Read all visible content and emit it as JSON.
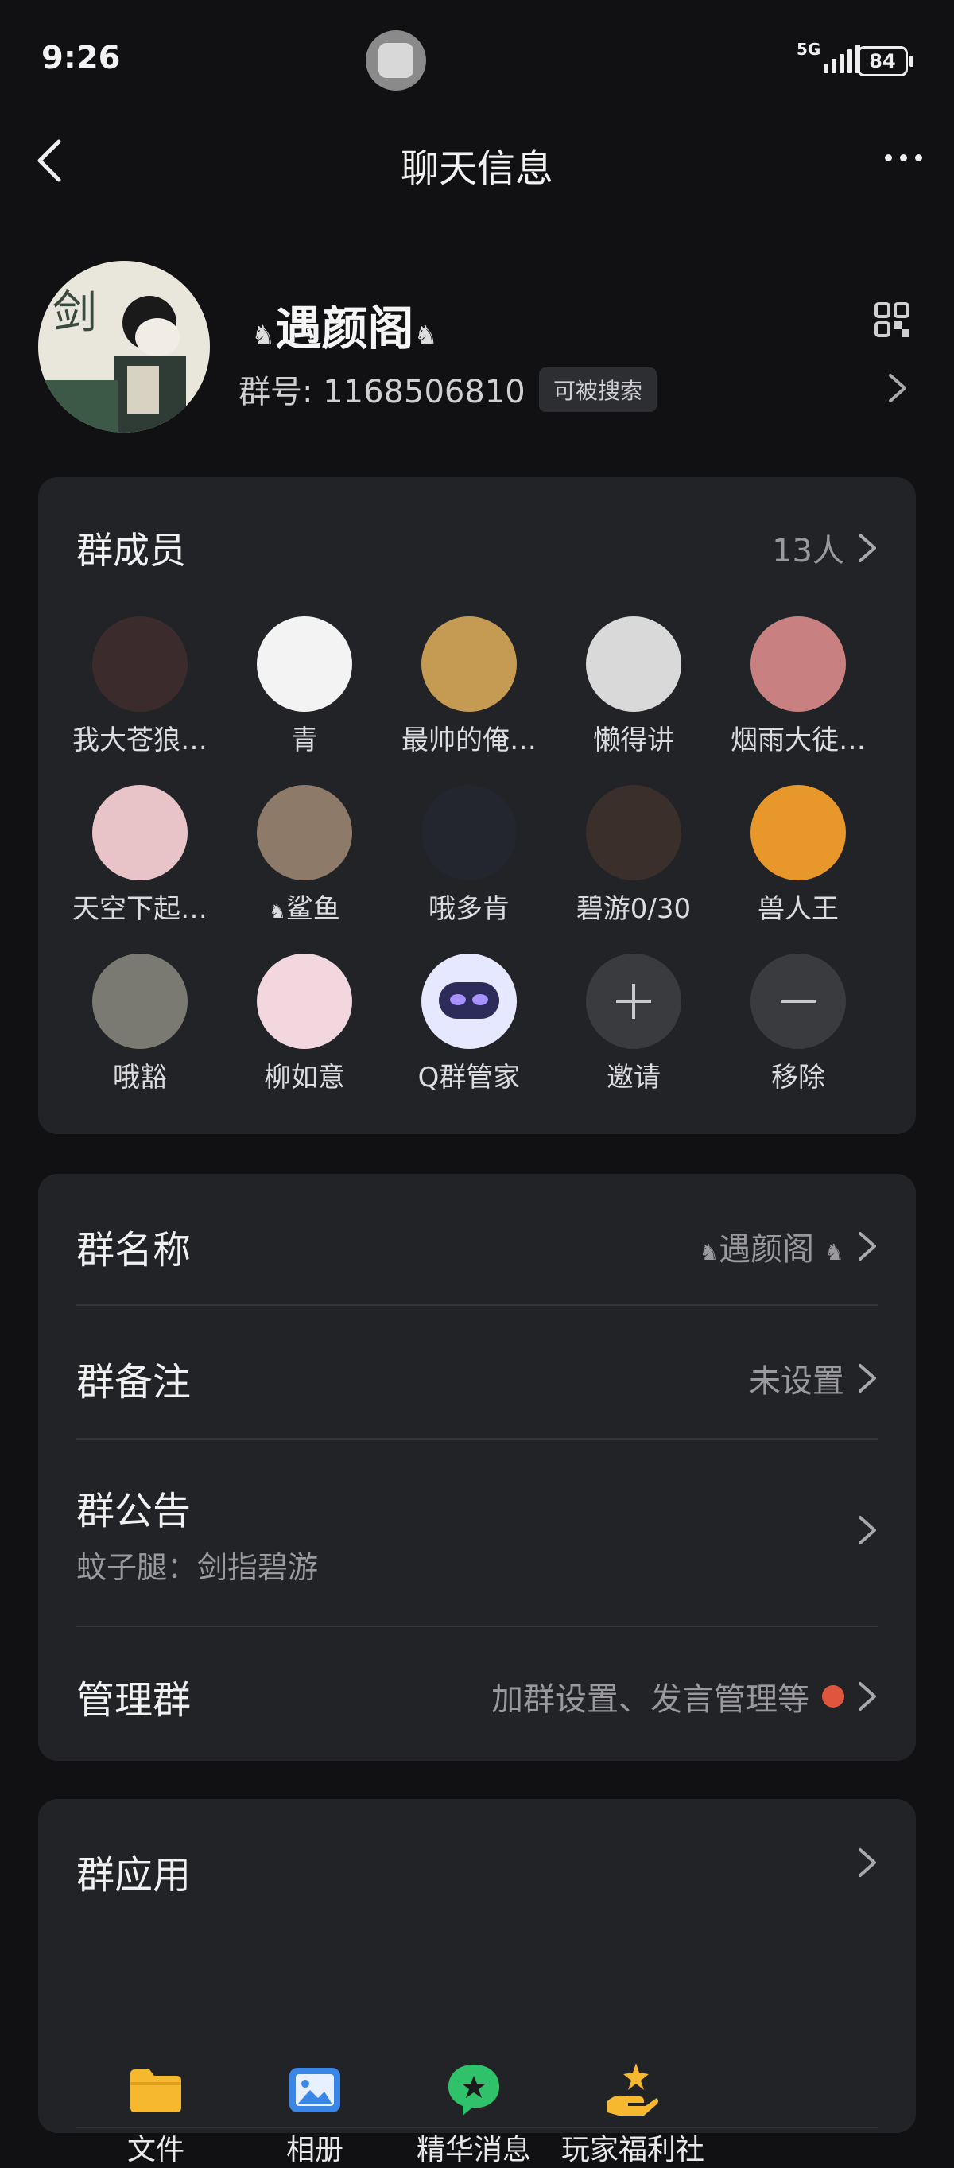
{
  "status_bar": {
    "time": "9:26",
    "network": "5G",
    "battery": "84"
  },
  "nav": {
    "title": "聊天信息"
  },
  "group": {
    "name": "遇颜阁",
    "id_label": "群号:",
    "id_value": "1168506810",
    "search_tag": "可被搜索"
  },
  "members_card": {
    "title": "群成员",
    "count": "13人",
    "members": [
      {
        "name": "我大苍狼…",
        "color": "#3b2b2c"
      },
      {
        "name": "青",
        "color": "#f3f3f3"
      },
      {
        "name": "最帅的俺…",
        "color": "#c59a52"
      },
      {
        "name": "懒得讲",
        "color": "#d9d9d9"
      },
      {
        "name": "烟雨大徒…",
        "color": "#c98080"
      },
      {
        "name": "天空下起…",
        "color": "#e8c4c8"
      },
      {
        "name": "鲨鱼",
        "color": "#8d7a68"
      },
      {
        "name": "哦多肯",
        "color": "#23262e"
      },
      {
        "name": "碧游0/30",
        "color": "#3a2f2a"
      },
      {
        "name": "兽人王",
        "color": "#e8972b"
      },
      {
        "name": "哦豁",
        "color": "#7a7a72"
      },
      {
        "name": "柳如意",
        "color": "#f3d7df"
      },
      {
        "name": "Q群管家",
        "color": "#e6e8ff"
      }
    ],
    "invite_label": "邀请",
    "remove_label": "移除"
  },
  "settings_card": {
    "group_name_label": "群名称",
    "group_name_value": "遇颜阁",
    "remark_label": "群备注",
    "remark_value": "未设置",
    "notice_label": "群公告",
    "notice_value": "蚊子腿：剑指碧游",
    "manage_label": "管理群",
    "manage_value": "加群设置、发言管理等"
  },
  "apps_card": {
    "title": "群应用",
    "apps": [
      {
        "label": "文件",
        "icon": "folder-icon"
      },
      {
        "label": "相册",
        "icon": "album-icon"
      },
      {
        "label": "精华消息",
        "icon": "star-chat-icon"
      },
      {
        "label": "玩家福利社",
        "icon": "gift-hand-icon"
      }
    ]
  },
  "colors": {
    "background": "#111113",
    "card": "#222326",
    "accent_red": "#e0553d",
    "file_yellow": "#f5b82e",
    "album_blue": "#3a86e6",
    "essence_green": "#2fc26b"
  }
}
